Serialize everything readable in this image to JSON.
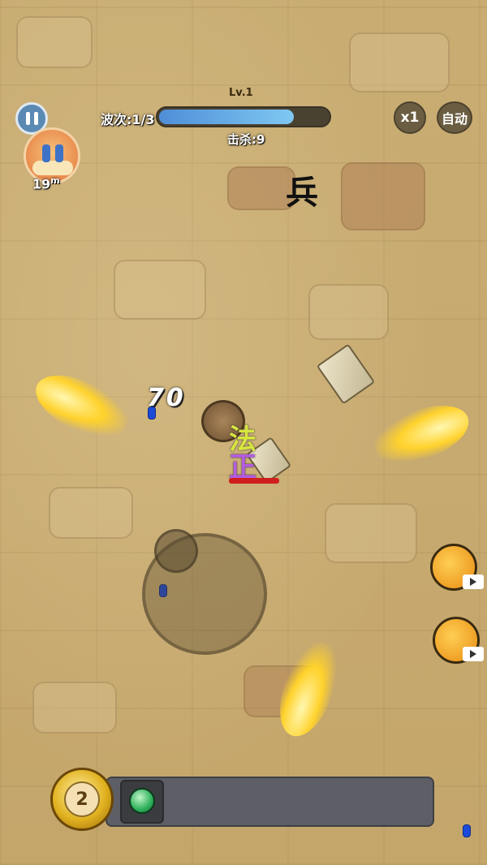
{
  "hud": {
    "level": "Lv.1",
    "wave_label": "波次:1/3",
    "wave_progress": 0.8,
    "kills": "击杀:9",
    "speed_label": "x1",
    "auto_label": "自动",
    "distance": "19",
    "distance_unit": "m"
  },
  "world": {
    "enemy_glyph": "兵",
    "damage_number": "70",
    "player_chars": [
      "法",
      "正"
    ]
  },
  "skill_bar": {
    "coin_count": "2"
  },
  "icons": {
    "pause": "pause-icon",
    "hero": "hero-portrait-icon",
    "meat": "meat-icon",
    "gourd": "gourd-icon",
    "video": "video-ad-icon",
    "skill": "green-orb-icon",
    "coin": "gold-coin-icon"
  }
}
